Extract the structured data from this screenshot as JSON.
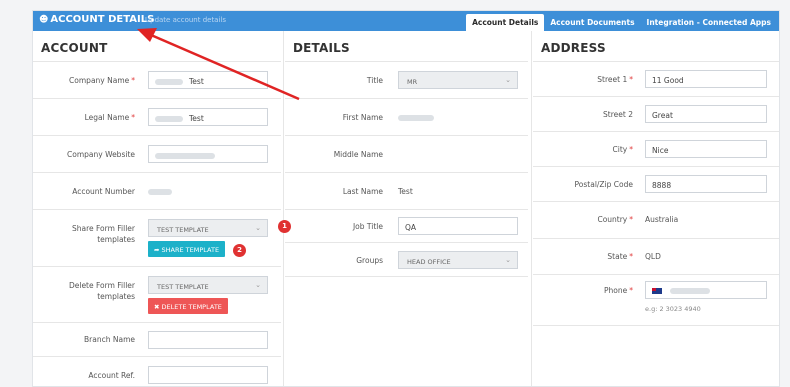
{
  "header": {
    "title": "ACCOUNT DETAILS",
    "subtitle": "Update account details",
    "tabs": [
      {
        "label": "Account Details",
        "active": true
      },
      {
        "label": "Account Documents",
        "active": false
      },
      {
        "label": "Integration - Connected Apps",
        "active": false
      }
    ],
    "color": "#3d8fd8"
  },
  "account": {
    "heading": "ACCOUNT",
    "company_name_label": "Company Name",
    "company_name_value": "Test",
    "legal_name_label": "Legal Name",
    "legal_name_value": "Test",
    "website_label": "Company Website",
    "account_number_label": "Account Number",
    "share_label_1": "Share Form Filler",
    "share_label_2": "templates",
    "share_select_value": "TEST TEMPLATE",
    "share_button": "SHARE TEMPLATE",
    "delete_label_1": "Delete Form Filler",
    "delete_label_2": "templates",
    "delete_select_value": "TEST TEMPLATE",
    "delete_button": "DELETE TEMPLATE",
    "branch_label": "Branch Name",
    "account_ref_label": "Account Ref."
  },
  "details": {
    "heading": "DETAILS",
    "title_label": "Title",
    "title_value": "MR",
    "first_name_label": "First Name",
    "middle_name_label": "Middle Name",
    "last_name_label": "Last Name",
    "last_name_value": "Test",
    "job_title_label": "Job Title",
    "job_title_value": "QA",
    "groups_label": "Groups",
    "groups_value": "HEAD OFFICE"
  },
  "address": {
    "heading": "ADDRESS",
    "street1_label": "Street 1",
    "street1_value": "11 Good",
    "street2_label": "Street 2",
    "street2_value": "Great",
    "city_label": "City",
    "city_value": "Nice",
    "postal_label": "Postal/Zip Code",
    "postal_value": "8888",
    "country_label": "Country",
    "country_value": "Australia",
    "state_label": "State",
    "state_value": "QLD",
    "phone_label": "Phone",
    "phone_hint": "e.g: 2 3023 4940"
  },
  "annotations": {
    "badge1": "1",
    "badge2": "2",
    "arrow_color": "#e02424"
  },
  "required_mark": "*",
  "icons": {
    "header_icon": "users-icon",
    "share_icon": "share-icon",
    "delete_icon": "times-icon",
    "chevron": "chevron-down-icon"
  }
}
